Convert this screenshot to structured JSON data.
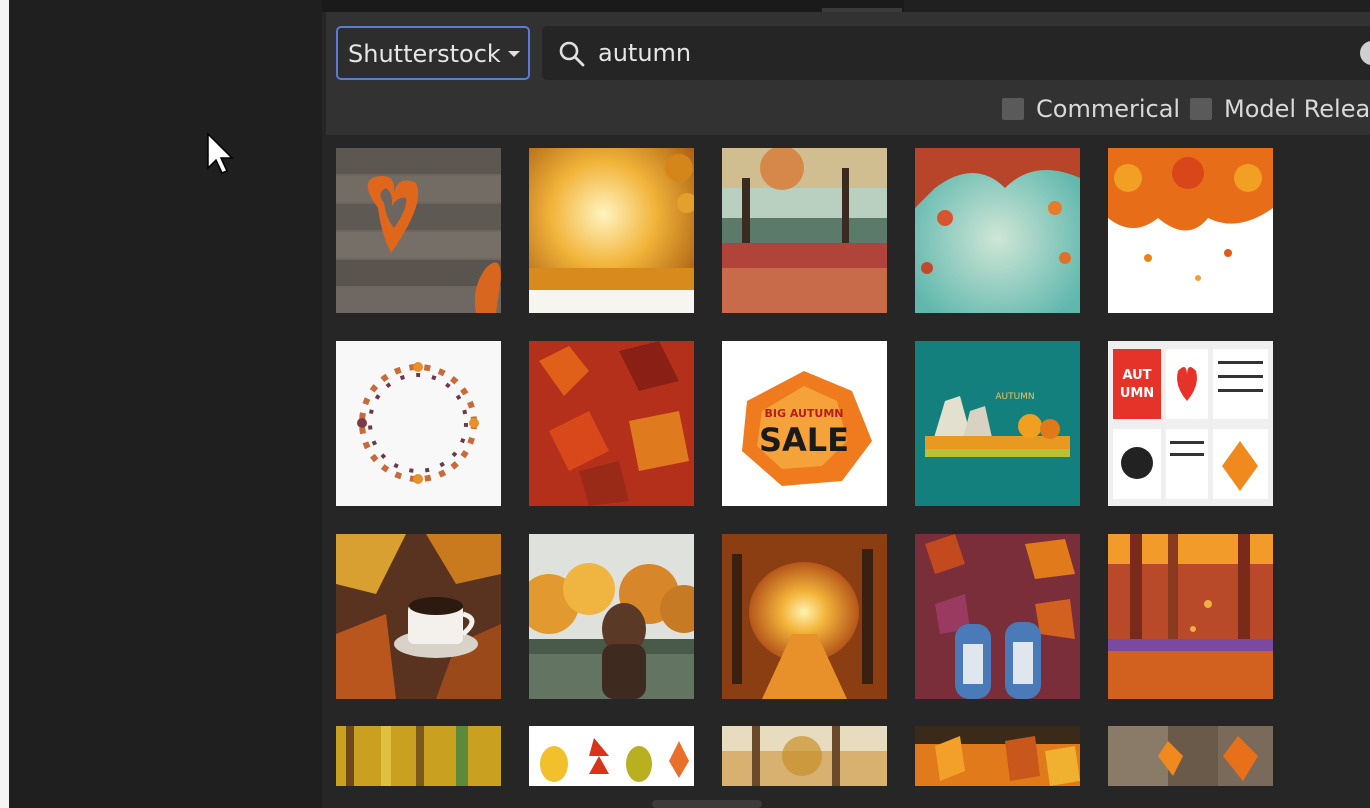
{
  "source_selector": {
    "label": "Shutterstock",
    "caret_icon": "caret-down-icon"
  },
  "search": {
    "value": "autumn",
    "icon": "search-icon"
  },
  "filters": [
    {
      "label": "Commerical",
      "checked": false
    },
    {
      "label": "Model Relea",
      "checked": false
    }
  ],
  "thumbnails": {
    "t1": {
      "overlay_text": ""
    },
    "t8": {
      "line1": "BIG AUTUMN",
      "line2": "SALE"
    },
    "t9": {
      "label": "AUTUMN"
    },
    "t10": {
      "line1": "AUT",
      "line2": "UMN"
    }
  },
  "colors": {
    "accent_border": "#5b7bd6",
    "panel_bg": "#262626",
    "toolbar_bg": "#323232",
    "left_pane_bg": "#1f1f1f"
  }
}
